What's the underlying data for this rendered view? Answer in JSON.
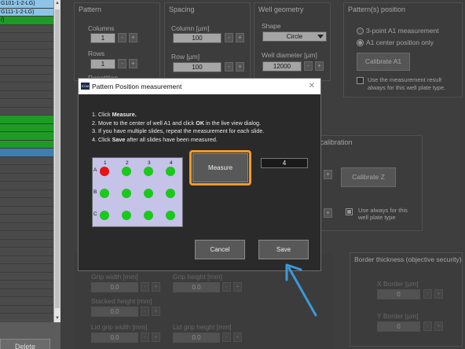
{
  "left_list": {
    "rows": [
      {
        "label": "G101-1-2-LG)",
        "style": "sel"
      },
      {
        "label": "G111-1-2-LG)",
        "style": "sel"
      },
      {
        "label": "/)",
        "style": "green"
      },
      {
        "label": "",
        "style": ""
      },
      {
        "label": "",
        "style": ""
      },
      {
        "label": "",
        "style": ""
      },
      {
        "label": "",
        "style": ""
      },
      {
        "label": "",
        "style": ""
      },
      {
        "label": "",
        "style": ""
      },
      {
        "label": "",
        "style": ""
      },
      {
        "label": "",
        "style": ""
      },
      {
        "label": "",
        "style": ""
      },
      {
        "label": "",
        "style": ""
      },
      {
        "label": "",
        "style": ""
      },
      {
        "label": "",
        "style": "green"
      },
      {
        "label": "",
        "style": "green"
      },
      {
        "label": "",
        "style": "green"
      },
      {
        "label": "",
        "style": "green"
      },
      {
        "label": "",
        "style": "blue"
      },
      {
        "label": "",
        "style": ""
      },
      {
        "label": "",
        "style": ""
      },
      {
        "label": "",
        "style": ""
      },
      {
        "label": "",
        "style": ""
      },
      {
        "label": "",
        "style": ""
      },
      {
        "label": "",
        "style": ""
      },
      {
        "label": "",
        "style": ""
      },
      {
        "label": "",
        "style": ""
      },
      {
        "label": "",
        "style": ""
      },
      {
        "label": "",
        "style": ""
      },
      {
        "label": "",
        "style": ""
      },
      {
        "label": "",
        "style": ""
      },
      {
        "label": "",
        "style": ""
      },
      {
        "label": "",
        "style": ""
      },
      {
        "label": "",
        "style": ""
      },
      {
        "label": "",
        "style": ""
      },
      {
        "label": "",
        "style": ""
      },
      {
        "label": "",
        "style": ""
      },
      {
        "label": "",
        "style": ""
      }
    ],
    "scroll_up": "▲",
    "scroll_down": "▼",
    "delete_label": "Delete"
  },
  "pattern": {
    "title": "Pattern",
    "columns_label": "Columns",
    "columns_value": "1",
    "rows_label": "Rows",
    "rows_value": "1",
    "repetition_label": "Repetition",
    "minus": "-",
    "plus": "+"
  },
  "spacing": {
    "title": "Spacing",
    "column_label": "Column [µm]",
    "column_value": "100",
    "row_label": "Row [µm]",
    "row_value": "100"
  },
  "well_geometry": {
    "title": "Well geometry",
    "shape_label": "Shape",
    "shape_value": "Circle",
    "diameter_label": "Well diameter [µm]",
    "diameter_value": "12000"
  },
  "pattern_position": {
    "title": "Pattern(s) position",
    "option1": "3-point A1 measurement",
    "option2": "A1 center position only",
    "calibrate_label": "Calibrate A1",
    "checkbox_label_line1": "Use the measurement result",
    "checkbox_label_line2": "always for this well plate type."
  },
  "calibration": {
    "title": "on calibration",
    "calibrate_z_label": "Calibrate Z",
    "use_always_line1": "Use always for this",
    "use_always_line2": "well plate type"
  },
  "grip": {
    "grip_width_label": "Grip width [mm]",
    "grip_width_value": "0.0",
    "grip_height_label": "Grip height [mm]",
    "grip_height_value": "0.0",
    "stacked_height_label": "Stacked height [mm]",
    "stacked_height_value": "0.0",
    "lid_grip_width_label": "Lid grip width [mm]",
    "lid_grip_width_value": "0.0",
    "lid_grip_height_label": "Lid grip height [mm]",
    "lid_grip_height_value": "0.0"
  },
  "border": {
    "title": "Border thickness (objective security)",
    "x_label": "X Border [µm]",
    "x_value": "0",
    "y_label": "Y Border [µm]",
    "y_value": "0"
  },
  "dialog": {
    "icon_text": "ECM",
    "title": "Pattern Position measurement",
    "close": "✕",
    "instructions": [
      "1. Click Measure.",
      "2. Move to the center of well A1 and click OK in the live view dialog.",
      "3. If you have multiple slides, repeat the measurement for each slide.",
      "4. Click Save after all slides have been measured."
    ],
    "plate_columns": [
      "1",
      "2",
      "3",
      "4"
    ],
    "plate_rows": [
      "A",
      "B",
      "C"
    ],
    "measure_label": "Measure",
    "count_value": "4",
    "cancel_label": "Cancel",
    "save_label": "Save"
  },
  "colors": {
    "highlight": "#f39a2c",
    "arrow": "#3a9ad9",
    "well_measured": "#e61414",
    "well_pending": "#1ac91a",
    "plate_bg": "#c5c3e8"
  }
}
